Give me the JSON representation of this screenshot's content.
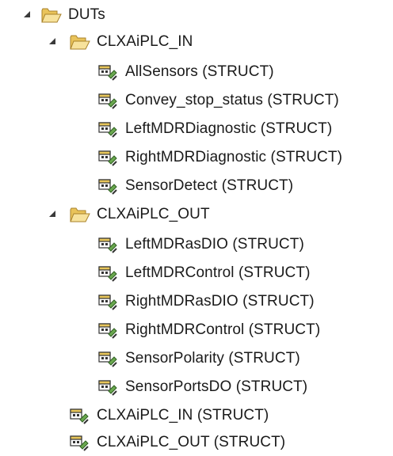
{
  "tree": {
    "root": {
      "label": "DUTs",
      "icon": "open-folder-icon"
    },
    "folders": [
      {
        "label": "CLXAiPLC_IN",
        "icon": "open-folder-icon",
        "items": [
          "AllSensors (STRUCT)",
          "Convey_stop_status (STRUCT)",
          "LeftMDRDiagnostic (STRUCT)",
          "RightMDRDiagnostic (STRUCT)",
          "SensorDetect (STRUCT)"
        ]
      },
      {
        "label": "CLXAiPLC_OUT",
        "icon": "open-folder-icon",
        "items": [
          "LeftMDRasDIO (STRUCT)",
          "LeftMDRControl (STRUCT)",
          "RightMDRasDIO (STRUCT)",
          "RightMDRControl (STRUCT)",
          "SensorPolarity (STRUCT)",
          "SensorPortsDO (STRUCT)"
        ]
      }
    ],
    "root_items": [
      "CLXAiPLC_IN (STRUCT)",
      "CLXAiPLC_OUT (STRUCT)"
    ],
    "item_icon": "struct-type-icon"
  }
}
